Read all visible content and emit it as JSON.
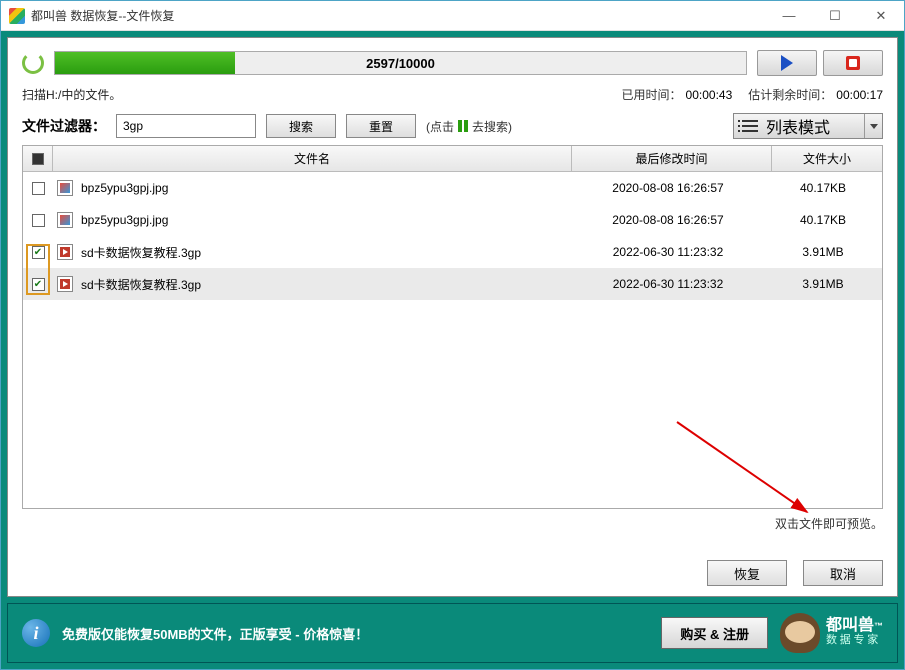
{
  "window": {
    "title": "都叫兽 数据恢复--文件恢复"
  },
  "progress": {
    "text": "2597/10000",
    "percent": 26
  },
  "status": {
    "scan_text": "扫描H:/中的文件。",
    "elapsed_label": "已用时间：",
    "elapsed_value": "00:00:43",
    "remaining_label": "估计剩余时间：",
    "remaining_value": "00:00:17"
  },
  "filter": {
    "label": "文件过滤器：",
    "value": "3gp",
    "search_btn": "搜索",
    "reset_btn": "重置",
    "hint_prefix": "(点击",
    "hint_suffix": "去搜索)",
    "view_mode": "列表模式"
  },
  "columns": {
    "name": "文件名",
    "date": "最后修改时间",
    "size": "文件大小"
  },
  "rows": [
    {
      "checked": false,
      "icon": "img",
      "name": "bpz5ypu3gpj.jpg",
      "date": "2020-08-08 16:26:57",
      "size": "40.17KB"
    },
    {
      "checked": false,
      "icon": "img",
      "name": "bpz5ypu3gpj.jpg",
      "date": "2020-08-08 16:26:57",
      "size": "40.17KB"
    },
    {
      "checked": true,
      "icon": "vid",
      "name": "sd卡数据恢复教程.3gp",
      "date": "2022-06-30 11:23:32",
      "size": "3.91MB"
    },
    {
      "checked": true,
      "icon": "vid",
      "name": "sd卡数据恢复教程.3gp",
      "date": "2022-06-30 11:23:32",
      "size": "3.91MB"
    }
  ],
  "footer_hint": "双击文件即可预览。",
  "actions": {
    "recover": "恢复",
    "cancel": "取消"
  },
  "promo": {
    "text": "免费版仅能恢复50MB的文件，正版享受 - 价格惊喜！",
    "buy_btn": "购买 & 注册",
    "brand1": "都叫兽",
    "brand2": "数 据 专 家"
  }
}
